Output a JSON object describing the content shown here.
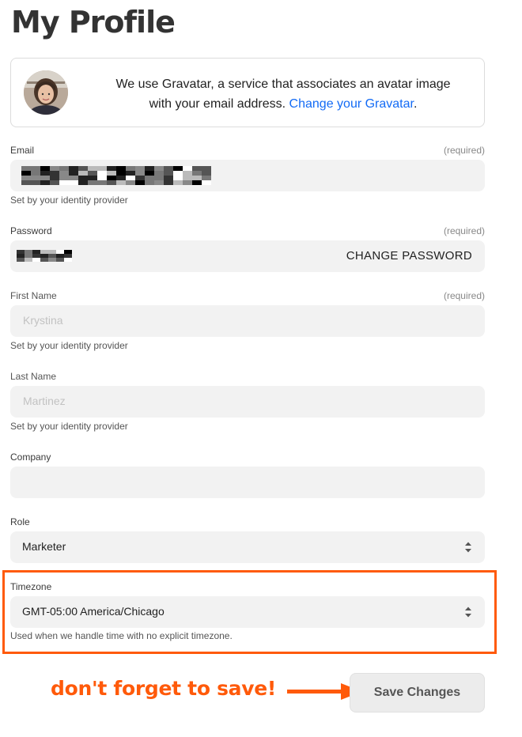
{
  "page_title": "My Profile",
  "gravatar": {
    "text_line1": "We use Gravatar, a service that associates an avatar image",
    "text_line2": "with your email address.",
    "link": "Change your Gravatar",
    "trailing": "."
  },
  "email": {
    "label": "Email",
    "required": "(required)",
    "hint": "Set by your identity provider"
  },
  "password": {
    "label": "Password",
    "required": "(required)",
    "change_label": "CHANGE PASSWORD"
  },
  "first_name": {
    "label": "First Name",
    "required": "(required)",
    "placeholder": "Krystina",
    "hint": "Set by your identity provider"
  },
  "last_name": {
    "label": "Last Name",
    "placeholder": "Martinez",
    "hint": "Set by your identity provider"
  },
  "company": {
    "label": "Company",
    "value": ""
  },
  "role": {
    "label": "Role",
    "value": "Marketer"
  },
  "timezone": {
    "label": "Timezone",
    "value": "GMT-05:00 America/Chicago",
    "hint": "Used when we handle time with no explicit timezone."
  },
  "annotation": "don't forget to save!",
  "save_label": "Save Changes",
  "colors": {
    "accent_link": "#136bf5",
    "annotation": "#ff5a0a",
    "field_bg": "#f2f2f2"
  },
  "icons": [
    "avatar",
    "select-arrows-icon",
    "arrow-right-icon"
  ]
}
